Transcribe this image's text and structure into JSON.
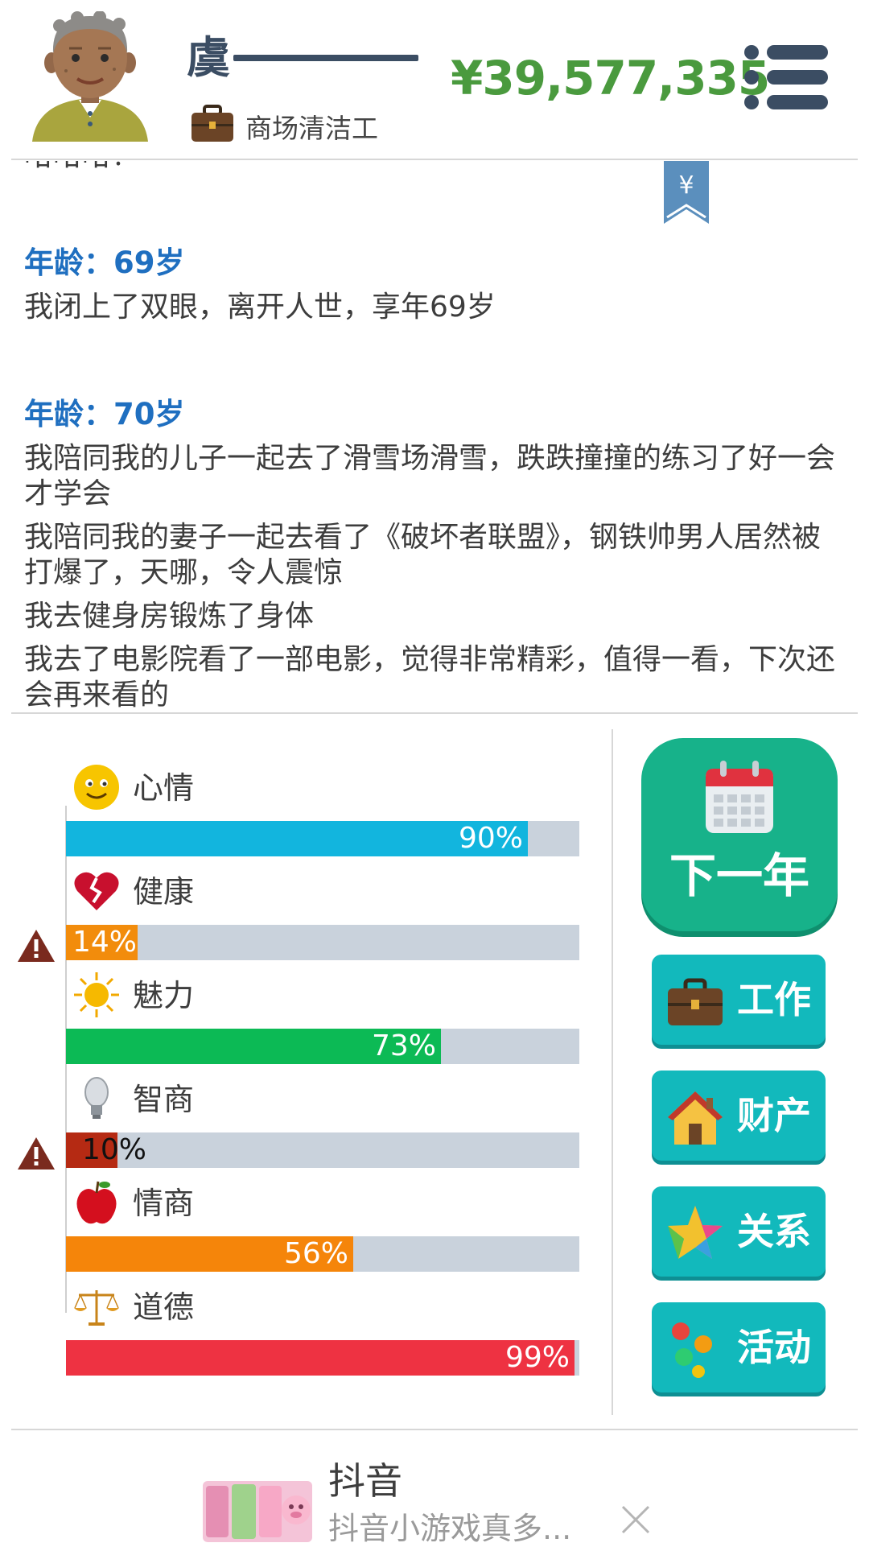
{
  "header": {
    "player_name": "虞",
    "job": "商场清洁工",
    "money": "¥39,577,335"
  },
  "log": {
    "partial_top": "哈哈哈！",
    "blocks": [
      {
        "age": "年龄：69岁",
        "entries": [
          "我闭上了双眼，离开人世，享年69岁"
        ]
      },
      {
        "age": "年龄：70岁",
        "entries": [
          "我陪同我的儿子一起去了滑雪场滑雪，跌跌撞撞的练习了好一会才学会",
          "我陪同我的妻子一起去看了《破坏者联盟》，钢铁帅男人居然被打爆了，天哪，令人震惊",
          "我去健身房锻炼了身体"
        ]
      }
    ],
    "cutoff_line": "我去了电影院看了一部电影，觉得非常精彩，值得一看，下次还会再来看的"
  },
  "stats": [
    {
      "label": "心情",
      "percent_text": "90%",
      "value": 0.9,
      "color": "#12b5de",
      "icon": "smiley-icon",
      "warning": false
    },
    {
      "label": "健康",
      "percent_text": "14%",
      "value": 0.14,
      "color": "#f28c0c",
      "icon": "broken-heart-icon",
      "warning": true
    },
    {
      "label": "魅力",
      "percent_text": "73%",
      "value": 0.73,
      "color": "#0cba55",
      "icon": "sun-icon",
      "warning": false
    },
    {
      "label": "智商",
      "percent_text": "10%",
      "value": 0.1,
      "color": "#b52a13",
      "icon": "lightbulb-icon",
      "warning": true
    },
    {
      "label": "情商",
      "percent_text": "56%",
      "value": 0.56,
      "color": "#f5850a",
      "icon": "apple-icon",
      "warning": false
    },
    {
      "label": "道德",
      "percent_text": "99%",
      "value": 0.99,
      "color": "#ee3242",
      "icon": "scales-icon",
      "warning": false
    }
  ],
  "actions": {
    "next_year": "下一年",
    "work": "工作",
    "property": "财产",
    "relations": "关系",
    "activities": "活动"
  },
  "ad": {
    "title": "抖音",
    "subtitle": "抖音小游戏真多..."
  },
  "colors": {
    "money": "#4a9a3e",
    "age_heading": "#1f6fc0",
    "next_year_button": "#17b28a",
    "action_button": "#12b9bc"
  }
}
